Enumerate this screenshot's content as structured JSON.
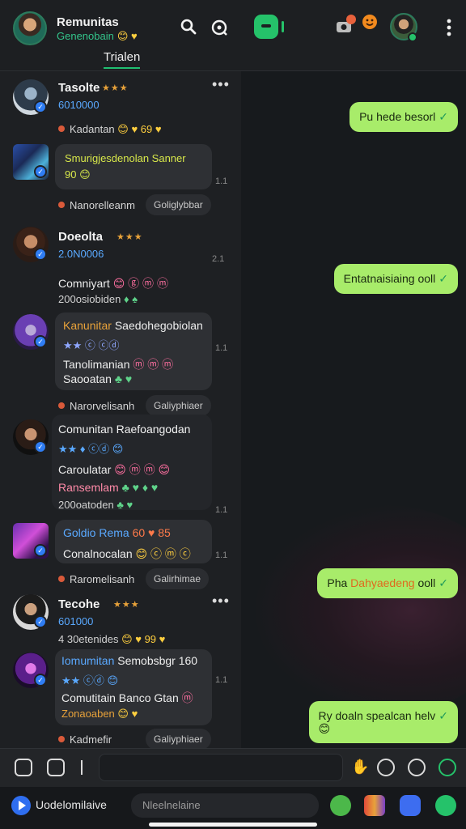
{
  "header": {
    "title": "Remunitas",
    "subtitle": "Genenobain",
    "subtitle_emoji": "😊 ♥",
    "tab": "Trialen",
    "search_icon": "search-icon",
    "refresh_icon": "refresh-icon",
    "menu_icon": "more-vertical-icon"
  },
  "feed": [
    {
      "name": "Tasolte",
      "stars": "★★★",
      "handle": "6010000",
      "reaction": "Kadantan",
      "reaction_emoji": "😊 ♥ 69 ♥",
      "more": "•••"
    },
    {
      "bubble_line1": "Smurigjesdenolan Sanner",
      "bubble_line2": "90 😊",
      "pill_left": "Nanorelleanm",
      "pill_right": "Goliglybbar",
      "time": "1.1"
    },
    {
      "name": "Doeolta",
      "stars": "★★★",
      "handle": "2.0N0006",
      "line1": "Comniyart",
      "line1_emoji": "😊 ⓖ ⓜ ⓜ",
      "line2": "200osiobiden",
      "line2_emoji": "♦ ♠",
      "time": "2.1"
    },
    {
      "bubble_title": "Kanunitar",
      "bubble_title_rest": "Saedohegobiolan",
      "bubble_sub": "★★ ⓒ ⓒⓓ",
      "line1": "Tanolimanian",
      "line1_emoji": "ⓜ ⓜ ⓜ",
      "line2": "Saooatan",
      "line2_emoji": "♣ ♥",
      "time": "1.1",
      "pill_left": "Narorvelisanh",
      "pill_right": "Galiyphiaer"
    },
    {
      "name": "Comunitan",
      "name_rest": "Raefoangodan",
      "sub": "★★ ♦ ⓒⓓ 😊",
      "line1": "Caroulatar",
      "line1_emoji": "😊 ⓜ ⓜ 😊",
      "line2": "Ransemlam",
      "line2_emoji": "♣ ♥ ♦ ♥",
      "line3": "200oatoden",
      "line3_emoji": "♣ ♥",
      "time": "1.1"
    },
    {
      "bubble_title": "Goldio Rema",
      "bubble_title_rest": "60 ♥ 85",
      "line1": "Conalnocalan",
      "line1_emoji": "😊 ⓒ ⓜ ⓒ",
      "time": "1.1",
      "pill_left": "Raromelisanh",
      "pill_right": "Galirhimae"
    },
    {
      "name": "Tecohe",
      "stars": "★★★",
      "handle": "601000",
      "line1": "4 30etenides",
      "line1_emoji": "😊 ♥ 99 ♥",
      "more": "•••"
    },
    {
      "bubble_title": "Iomumitan",
      "bubble_title_rest": "Semobsbgr 160",
      "bubble_sub": "★★ ⓒⓓ 😊",
      "line1": "Comutitain Banco Gtan",
      "line1_emoji": "ⓜ",
      "line2": "Zonaoaben",
      "line2_emoji": "😊 ♥",
      "time": "1.1",
      "pill_left": "Kadmefir",
      "pill_right": "Galiyphiaer"
    }
  ],
  "chat": {
    "messages": [
      {
        "text": "Pu hede besorl",
        "check": "✓"
      },
      {
        "text": "Entatnaisiaing ooll",
        "check": "✓"
      },
      {
        "text_pre": "Pha ",
        "text_hl": "Dahyaedeng",
        "text_post": " ooll",
        "check": "✓"
      },
      {
        "text": "Ry doaln spealcan helv",
        "check": "✓",
        "line2": "😊"
      }
    ]
  },
  "composer": {
    "placeholder": "",
    "icons": [
      "image-icon",
      "sticker-icon",
      "cursor-icon",
      "thumbs-up-icon",
      "gif-icon",
      "emoji-icon",
      "send-icon"
    ]
  },
  "bottombar": {
    "label": "Uodelomilaive",
    "search_placeholder": "Nleelnelaine",
    "apps": [
      "green-app-icon",
      "film-app-icon",
      "game-app-icon",
      "green-send-app-icon"
    ]
  },
  "colors": {
    "accent_green": "#25c26a",
    "bubble_green": "#a8ec6a",
    "verify_blue": "#2f7df3"
  }
}
